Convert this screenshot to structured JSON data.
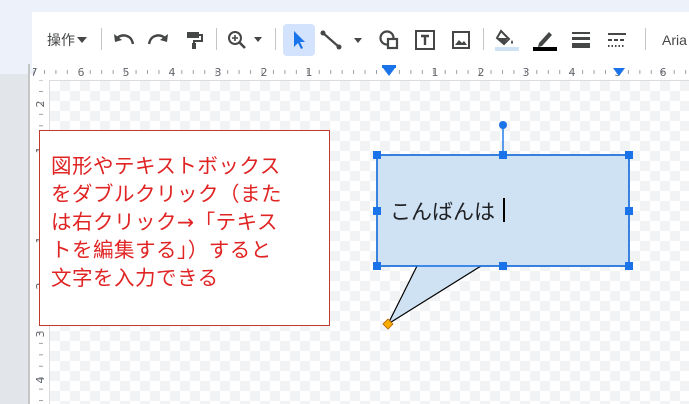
{
  "toolbar": {
    "menu_label": "操作",
    "font_name": "Aria",
    "icons": [
      "undo-icon",
      "redo-icon",
      "paint-format-icon",
      "zoom-icon",
      "select-icon",
      "line-icon",
      "shape-icon",
      "textbox-icon",
      "image-icon",
      "fill-color-icon",
      "border-color-icon",
      "border-weight-icon",
      "border-dash-icon"
    ]
  },
  "ruler": {
    "horizontal_labels": [
      "7",
      "6",
      "5",
      "4",
      "3",
      "2",
      "1",
      "1",
      "2",
      "3",
      "4",
      "5",
      "6"
    ],
    "vertical_labels": [
      "2",
      "1",
      "1",
      "2",
      "3",
      "4"
    ]
  },
  "note": {
    "lines": [
      "図形やテキストボックス",
      "をダブルクリック（また",
      "は右クリック→「テキス",
      "トを編集する」）すると",
      "文字を入力できる"
    ]
  },
  "bubble": {
    "text": "こんばんは"
  },
  "colors": {
    "accent": "#1a73e8",
    "note_text": "#e02424",
    "note_border": "#c0392b",
    "bubble_fill": "#cfe2f3"
  }
}
